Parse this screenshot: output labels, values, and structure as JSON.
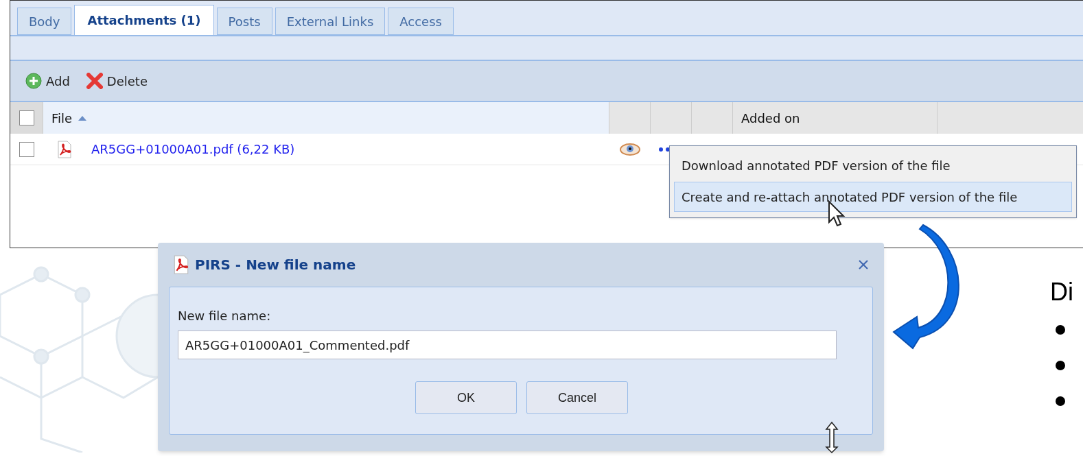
{
  "tabs": [
    {
      "label": "Body",
      "selected": false
    },
    {
      "label": "Attachments (1)",
      "selected": true
    },
    {
      "label": "Posts",
      "selected": false
    },
    {
      "label": "External Links",
      "selected": false
    },
    {
      "label": "Access",
      "selected": false
    }
  ],
  "toolbar": [
    {
      "kind": "add",
      "label": "Add"
    },
    {
      "kind": "delete",
      "label": "Delete"
    }
  ],
  "table": {
    "header_checked": false,
    "columns": [
      {
        "label": "File",
        "sorted": true
      },
      {},
      {},
      {},
      {
        "label": "Added on",
        "sorted": false
      }
    ],
    "rows": [
      {
        "checked": false,
        "file": "AR5GG+01000A01.pdf (6,22 KB)"
      }
    ]
  },
  "context_menu": [
    {
      "label": "Download annotated PDF version of the file",
      "selected": false
    },
    {
      "label": "Create and re-attach annotated PDF version of the file",
      "selected": true
    }
  ],
  "dialog": {
    "title": "PIRS - New file name",
    "field_label": "New file name:",
    "field_value": "AR5GG+01000A01_Commented.pdf",
    "buttons": [
      "OK",
      "Cancel"
    ]
  },
  "slide": {
    "heading": "Di"
  }
}
